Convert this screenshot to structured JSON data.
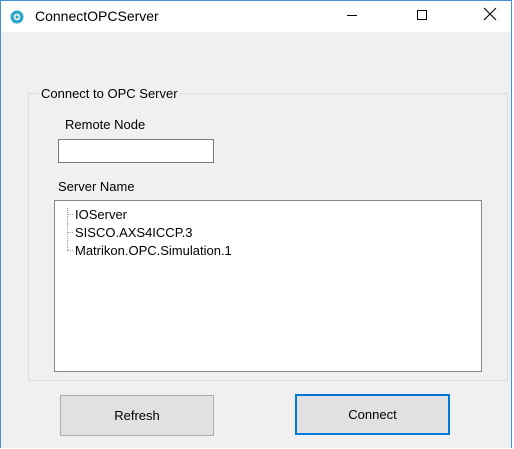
{
  "window": {
    "title": "ConnectOPCServer",
    "accent_color": "#0078d7",
    "app_icon": "opc-app-icon",
    "controls": {
      "minimize_icon": "minimize-icon",
      "maximize_icon": "maximize-icon",
      "close_icon": "close-icon"
    }
  },
  "group": {
    "legend": "Connect to OPC Server",
    "remote_node_label": "Remote Node",
    "remote_node_value": "",
    "server_name_label": "Server Name",
    "servers": [
      "IOServer",
      "SISCO.AXS4ICCP.3",
      "Matrikon.OPC.Simulation.1"
    ]
  },
  "buttons": {
    "refresh_label": "Refresh",
    "connect_label": "Connect"
  }
}
